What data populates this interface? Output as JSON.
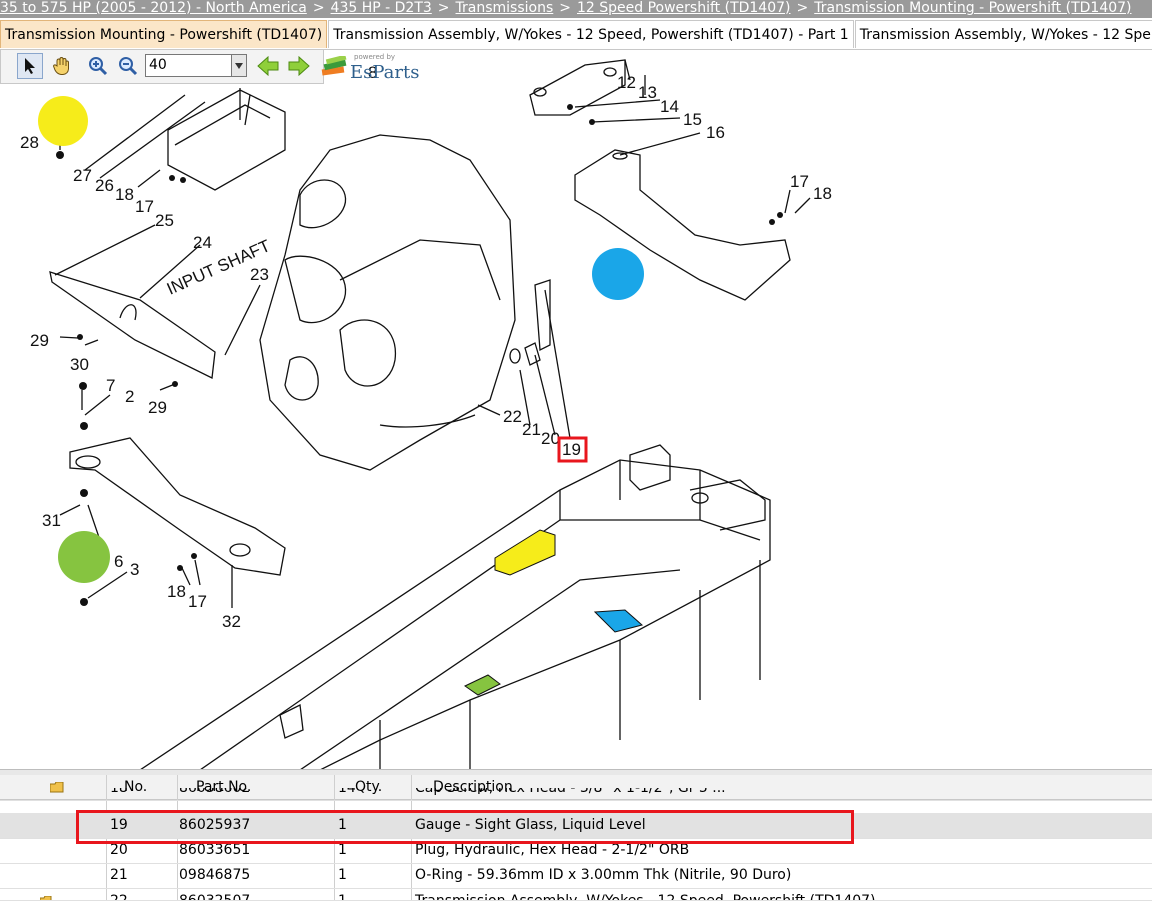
{
  "breadcrumb": {
    "items": [
      "35 to 575 HP (2005 - 2012) - North America",
      "435 HP - D2T3",
      "Transmissions",
      "12 Speed Powershift (TD1407)",
      "Transmission Mounting - Powershift (TD1407)"
    ],
    "separator": ">"
  },
  "tabs": [
    {
      "label": "Transmission Mounting - Powershift (TD1407)",
      "active": true
    },
    {
      "label": "Transmission Assembly, W/Yokes - 12 Speed, Powershift (TD1407) - Part 1",
      "active": false
    },
    {
      "label": "Transmission Assembly, W/Yokes - 12 Spe",
      "active": false
    }
  ],
  "toolbar": {
    "zoom_value": "40",
    "icons": [
      "pointer-icon",
      "hand-pan-icon",
      "zoom-in-icon",
      "zoom-out-icon",
      "arrow-left-icon",
      "arrow-right-icon"
    ],
    "logo_powered_by": "powered by",
    "logo_text": "EsParts"
  },
  "diagram": {
    "labels": [
      "28",
      "27",
      "26",
      "18",
      "17",
      "25",
      "24",
      "INPUT SHAFT",
      "23",
      "29",
      "30",
      "29",
      "7",
      "2",
      "31",
      "6",
      "3",
      "18",
      "17",
      "32",
      "12",
      "13",
      "14",
      "15",
      "16",
      "17",
      "18",
      "22",
      "21",
      "20",
      "19",
      "8"
    ],
    "highlighted_callout": "19",
    "markers": [
      {
        "name": "yellow-marker",
        "color": "#f6ec1a"
      },
      {
        "name": "blue-marker",
        "color": "#1aa6e8"
      },
      {
        "name": "green-marker",
        "color": "#86c440"
      }
    ],
    "highlight_color": "#e8161d"
  },
  "grid": {
    "columns": [
      "No.",
      "Part No.",
      "Qty.",
      "Description"
    ],
    "rows": [
      {
        "no": "18",
        "part": "86038602",
        "qty": "14",
        "desc": "Cap Screw, Hex Head - 3/8\" x 1-1/2\", Gr 5 ..."
      },
      {
        "no": "19",
        "part": "86025937",
        "qty": "1",
        "desc": "Gauge - Sight Glass, Liquid Level",
        "selected": true
      },
      {
        "no": "20",
        "part": "86033651",
        "qty": "1",
        "desc": "Plug, Hydraulic, Hex Head - 2-1/2\" ORB"
      },
      {
        "no": "21",
        "part": "09846875",
        "qty": "1",
        "desc": "O-Ring - 59.36mm ID x 3.00mm Thk (Nitrile, 90 Duro)"
      },
      {
        "no": "22",
        "part": "86032507",
        "qty": "1",
        "desc": "Transmission Assembly, W/Yokes - 12 Speed, Powershift (TD1407)"
      }
    ]
  }
}
